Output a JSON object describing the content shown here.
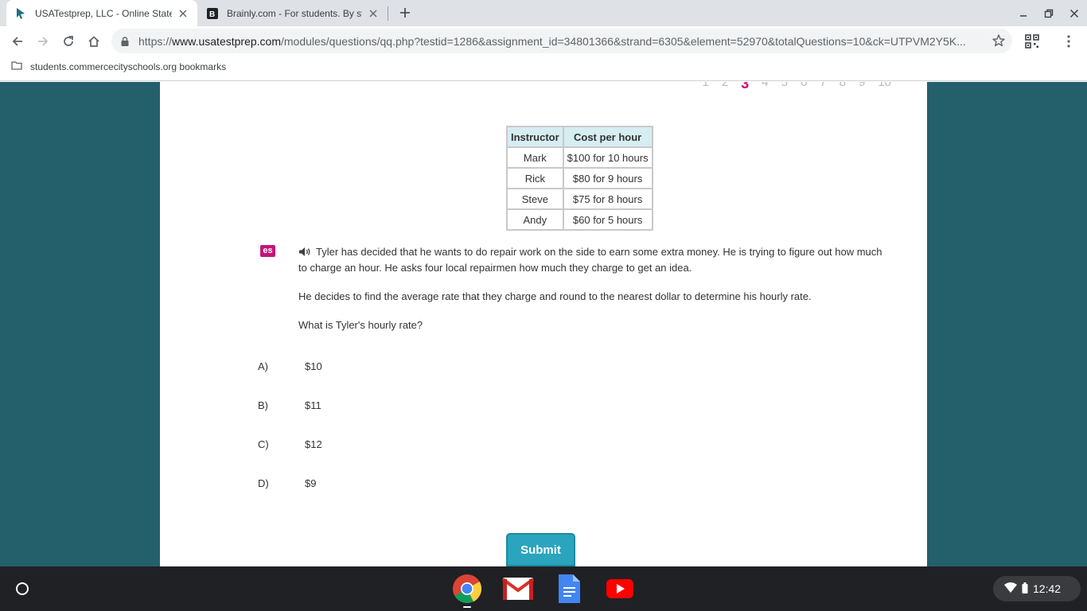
{
  "browser": {
    "tabs": [
      {
        "title": "USATestprep, LLC - Online State-S",
        "favicon": "usatestprep-cursor-icon",
        "active": true
      },
      {
        "title": "Brainly.com - For students. By st",
        "favicon": "brainly-b-icon",
        "active": false
      }
    ],
    "url": {
      "scheme": "https://",
      "host": "www.usatestprep.com",
      "path": "/modules/questions/qq.php?testid=1286&assignment_id=34801366&strand=6305&element=52970&totalQuestions=10&ck=UTPVM2Y5K..."
    },
    "bookmark_folder": "students.commercecityschools.org bookmarks"
  },
  "question_nav": {
    "numbers": [
      "1",
      "2",
      "3",
      "4",
      "5",
      "6",
      "7",
      "8",
      "9",
      "10"
    ],
    "current": "3"
  },
  "rate_table": {
    "headers": [
      "Instructor",
      "Cost per hour"
    ],
    "rows": [
      [
        "Mark",
        "$100 for 10 hours"
      ],
      [
        "Rick",
        "$80 for 9 hours"
      ],
      [
        "Steve",
        "$75 for 8 hours"
      ],
      [
        "Andy",
        "$60 for 5 hours"
      ]
    ]
  },
  "question": {
    "badge": "es",
    "paragraph1": "Tyler has decided that he wants to do repair work on the side to earn some extra money. He is trying to figure out how much to charge an hour. He asks four local repairmen how much they charge to get an idea.",
    "paragraph2": "He decides to find the average rate that they charge and round to the nearest dollar to determine his hourly rate.",
    "paragraph3": "What is Tyler's hourly rate?"
  },
  "choices": [
    {
      "letter": "A)",
      "text": "$10"
    },
    {
      "letter": "B)",
      "text": "$11"
    },
    {
      "letter": "C)",
      "text": "$12"
    },
    {
      "letter": "D)",
      "text": "$9"
    }
  ],
  "submit_label": "Submit",
  "shelf": {
    "apps": [
      "chrome-icon",
      "gmail-icon",
      "google-docs-icon",
      "youtube-icon"
    ],
    "time": "12:42"
  },
  "colors": {
    "page_background": "#24606b",
    "accent_magenta": "#c3157a",
    "table_header": "#d6edf1",
    "submit_button": "#2aa5bd"
  }
}
